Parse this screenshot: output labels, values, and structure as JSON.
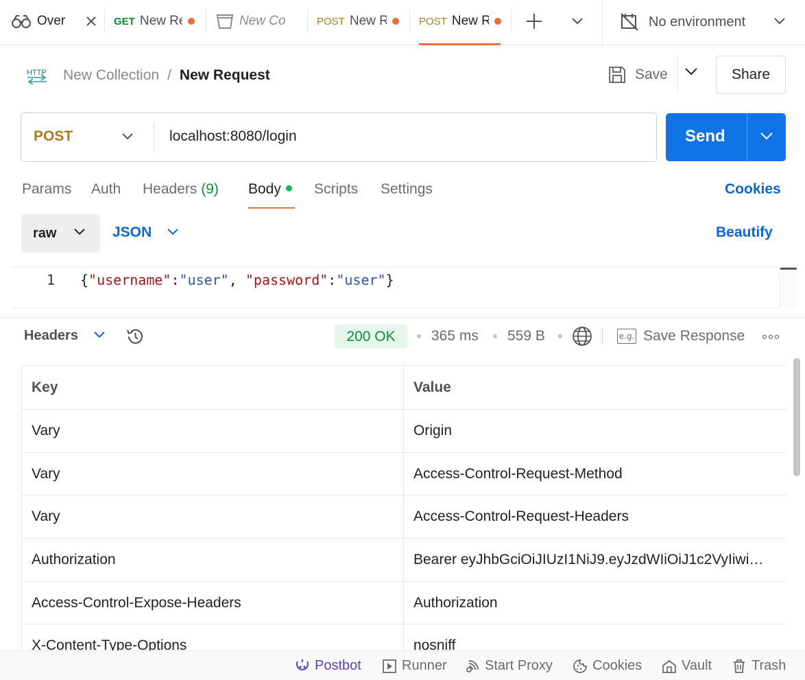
{
  "tabs": [
    {
      "method": "",
      "label": "Over",
      "dirty": false
    },
    {
      "method": "GET",
      "label": "New Re",
      "dirty": true
    },
    {
      "method": "",
      "label": "New Co",
      "dirty": false
    },
    {
      "method": "POST",
      "label": "New R",
      "dirty": true
    },
    {
      "method": "POST",
      "label": "New R",
      "dirty": true,
      "active": true
    }
  ],
  "environment": {
    "label": "No environment"
  },
  "breadcrumb": {
    "collection": "New Collection",
    "separator": "/",
    "request": "New Request",
    "protocol_icon": "HTTP"
  },
  "toolbar": {
    "save_label": "Save",
    "share_label": "Share"
  },
  "request": {
    "method": "POST",
    "url": "localhost:8080/login",
    "send_label": "Send"
  },
  "request_tabs": {
    "params": "Params",
    "auth": "Auth",
    "headers": "Headers",
    "headers_count": "(9)",
    "body": "Body",
    "scripts": "Scripts",
    "settings": "Settings",
    "cookies": "Cookies",
    "active": "Body"
  },
  "body_options": {
    "mode": "raw",
    "language": "JSON",
    "beautify": "Beautify"
  },
  "editor": {
    "line_number": "1",
    "brace_open": "{",
    "key1": "\"username\"",
    "colon": ":",
    "val1": "\"user\"",
    "comma": ", ",
    "key2": "\"password\"",
    "val2": "\"user\"",
    "brace_close": "}"
  },
  "response": {
    "tab_label": "Headers",
    "status": "200 OK",
    "time": "365 ms",
    "size": "559 B",
    "save_response": "Save Response",
    "eg_icon": "e.g."
  },
  "headers_table": {
    "columns": [
      "Key",
      "Value"
    ],
    "rows": [
      {
        "key": "Vary",
        "value": "Origin"
      },
      {
        "key": "Vary",
        "value": "Access-Control-Request-Method"
      },
      {
        "key": "Vary",
        "value": "Access-Control-Request-Headers"
      },
      {
        "key": "Authorization",
        "value": "Bearer eyJhbGciOiJIUzI1NiJ9.eyJzdWIiOiJ1c2VyIiwi…"
      },
      {
        "key": "Access-Control-Expose-Headers",
        "value": "Authorization"
      },
      {
        "key": "X-Content-Type-Options",
        "value": "nosniff"
      }
    ]
  },
  "statusbar": {
    "postbot": "Postbot",
    "runner": "Runner",
    "start_proxy": "Start Proxy",
    "cookies": "Cookies",
    "vault": "Vault",
    "trash": "Trash"
  },
  "colors": {
    "accent_orange": "#f26b3a",
    "send_blue": "#1174e6",
    "link_blue": "#0b66d1",
    "post_method": "#ab7c1d",
    "get_method": "#0f8a3c",
    "status_ok_bg": "#e5f6ea",
    "postbot_purple": "#5b3fbf"
  }
}
